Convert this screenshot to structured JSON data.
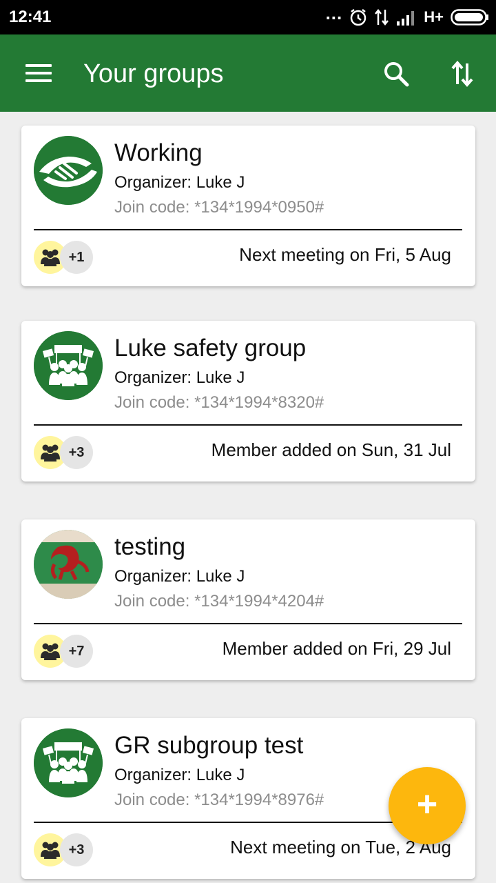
{
  "status_bar": {
    "time": "12:41",
    "dots": "...",
    "network": "H+"
  },
  "app_bar": {
    "title": "Your groups",
    "menu_icon": "hamburger-menu-icon",
    "search_icon": "search-icon",
    "sort_icon": "sort-icon"
  },
  "colors": {
    "primary": "#237a34",
    "accent": "#fdb70d",
    "member_badge": "#fff59d",
    "muted_text": "#8d8d8d"
  },
  "groups": [
    {
      "name": "Working",
      "organizer": "Organizer: Luke J",
      "join_code": "Join code: *134*1994*0950#",
      "member_count": "+1",
      "event": "Next meeting on Fri, 5 Aug",
      "avatar": "handshake-icon"
    },
    {
      "name": "Luke safety group",
      "organizer": "Organizer: Luke J",
      "join_code": "Join code: *134*1994*8320#",
      "member_count": "+3",
      "event": "Member added on Sun, 31 Jul",
      "avatar": "protest-group-icon"
    },
    {
      "name": "testing",
      "organizer": "Organizer: Luke J",
      "join_code": "Join code: *134*1994*4204#",
      "member_count": "+7",
      "event": "Member added on Fri, 29 Jul",
      "avatar": "photo-avatar"
    },
    {
      "name": "GR subgroup test",
      "organizer": "Organizer: Luke J",
      "join_code": "Join code: *134*1994*8976#",
      "member_count": "+3",
      "event": "Next meeting on Tue, 2 Aug",
      "avatar": "protest-group-icon"
    }
  ],
  "fab": {
    "label": "+",
    "icon": "add-icon"
  }
}
